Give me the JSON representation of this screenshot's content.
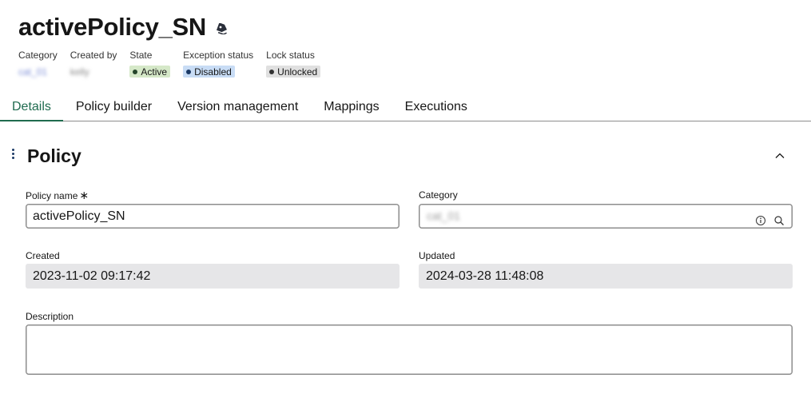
{
  "header": {
    "title": "activePolicy_SN",
    "icon": "tag-icon"
  },
  "meta": {
    "category": {
      "label": "Category",
      "value": "cat_01"
    },
    "created_by": {
      "label": "Created by",
      "value": "kelly"
    },
    "state": {
      "label": "State",
      "value": "Active",
      "color": "#d5e8c8"
    },
    "exception_status": {
      "label": "Exception status",
      "value": "Disabled",
      "color": "#c8dcf5"
    },
    "lock_status": {
      "label": "Lock status",
      "value": "Unlocked",
      "color": "#e0e0e0"
    }
  },
  "tabs": [
    {
      "label": "Details",
      "active": true
    },
    {
      "label": "Policy builder",
      "active": false
    },
    {
      "label": "Version management",
      "active": false
    },
    {
      "label": "Mappings",
      "active": false
    },
    {
      "label": "Executions",
      "active": false
    }
  ],
  "section": {
    "title": "Policy",
    "collapse_icon": "chevron-up-icon",
    "menu_icon": "kebab-icon"
  },
  "form": {
    "policy_name": {
      "label": "Policy name",
      "required_mark": "∗",
      "value": "activePolicy_SN"
    },
    "category": {
      "label": "Category",
      "value": "cat_01",
      "icons": [
        "info-icon",
        "search-icon"
      ]
    },
    "created": {
      "label": "Created",
      "value": "2023-11-02 09:17:42"
    },
    "updated": {
      "label": "Updated",
      "value": "2024-03-28 11:48:08"
    },
    "description": {
      "label": "Description",
      "value": ""
    }
  },
  "colors": {
    "accent": "#1f6b4f",
    "readonly_bg": "#e6e6e8"
  }
}
